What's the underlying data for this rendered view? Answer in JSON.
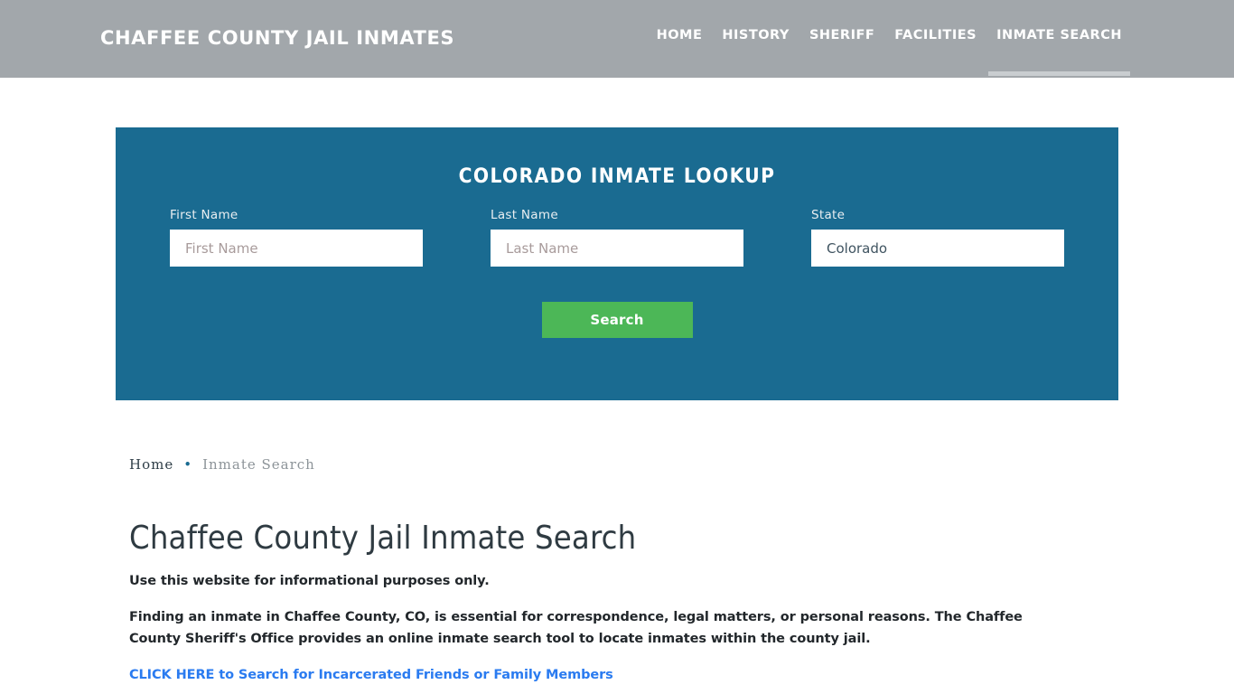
{
  "header": {
    "brand": "CHAFFEE COUNTY JAIL INMATES",
    "nav": [
      {
        "label": "HOME",
        "active": false
      },
      {
        "label": "HISTORY",
        "active": false
      },
      {
        "label": "SHERIFF",
        "active": false
      },
      {
        "label": "FACILITIES",
        "active": false
      },
      {
        "label": "INMATE SEARCH",
        "active": true
      }
    ],
    "bg_color": "#a2a7ab"
  },
  "lookup": {
    "title": "COLORADO INMATE LOOKUP",
    "panel_color": "#1a6b91",
    "first_name": {
      "label": "First Name",
      "placeholder": "First Name",
      "value": ""
    },
    "last_name": {
      "label": "Last Name",
      "placeholder": "Last Name",
      "value": ""
    },
    "state": {
      "label": "State",
      "selected": "Colorado",
      "options": [
        "Colorado"
      ]
    },
    "search_button": {
      "label": "Search",
      "color": "#4cb757"
    }
  },
  "breadcrumb": {
    "home": "Home",
    "separator": "•",
    "current": "Inmate Search"
  },
  "main": {
    "title": "Chaffee County Jail Inmate Search",
    "lede": "Use this website for informational purposes only.",
    "paragraph": "Finding an inmate in Chaffee County, CO, is essential for correspondence, legal matters, or personal reasons. The Chaffee County Sheriff's Office provides an online inmate search tool to locate inmates within the county jail.",
    "cta_link": "CLICK HERE to Search for Incarcerated Friends or Family Members",
    "link_color": "#2a7bf0"
  }
}
